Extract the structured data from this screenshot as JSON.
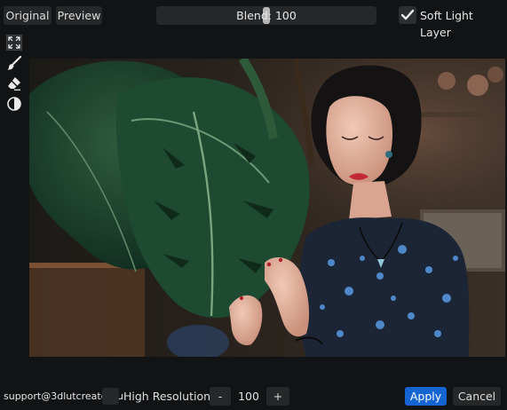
{
  "toolbar": {
    "original_label": "Original",
    "preview_label": "Preview",
    "blend_label": "Blend: 100",
    "blend_value": 100,
    "soft_light_label": "Soft Light Layer",
    "soft_light_checked": true
  },
  "tools": [
    {
      "icon": "fit-screen-icon"
    },
    {
      "icon": "brush-icon"
    },
    {
      "icon": "eraser-icon"
    },
    {
      "icon": "contrast-icon"
    }
  ],
  "footer": {
    "support_email": "support@3dlutcreator.ru",
    "high_resolution_label": "High Resolution",
    "high_resolution_checked": false,
    "minus_label": "-",
    "resolution_value": "100",
    "plus_label": "+",
    "apply_label": "Apply",
    "cancel_label": "Cancel"
  },
  "colors": {
    "background": "#121314",
    "button": "#262728",
    "accent": "#1464d2"
  }
}
